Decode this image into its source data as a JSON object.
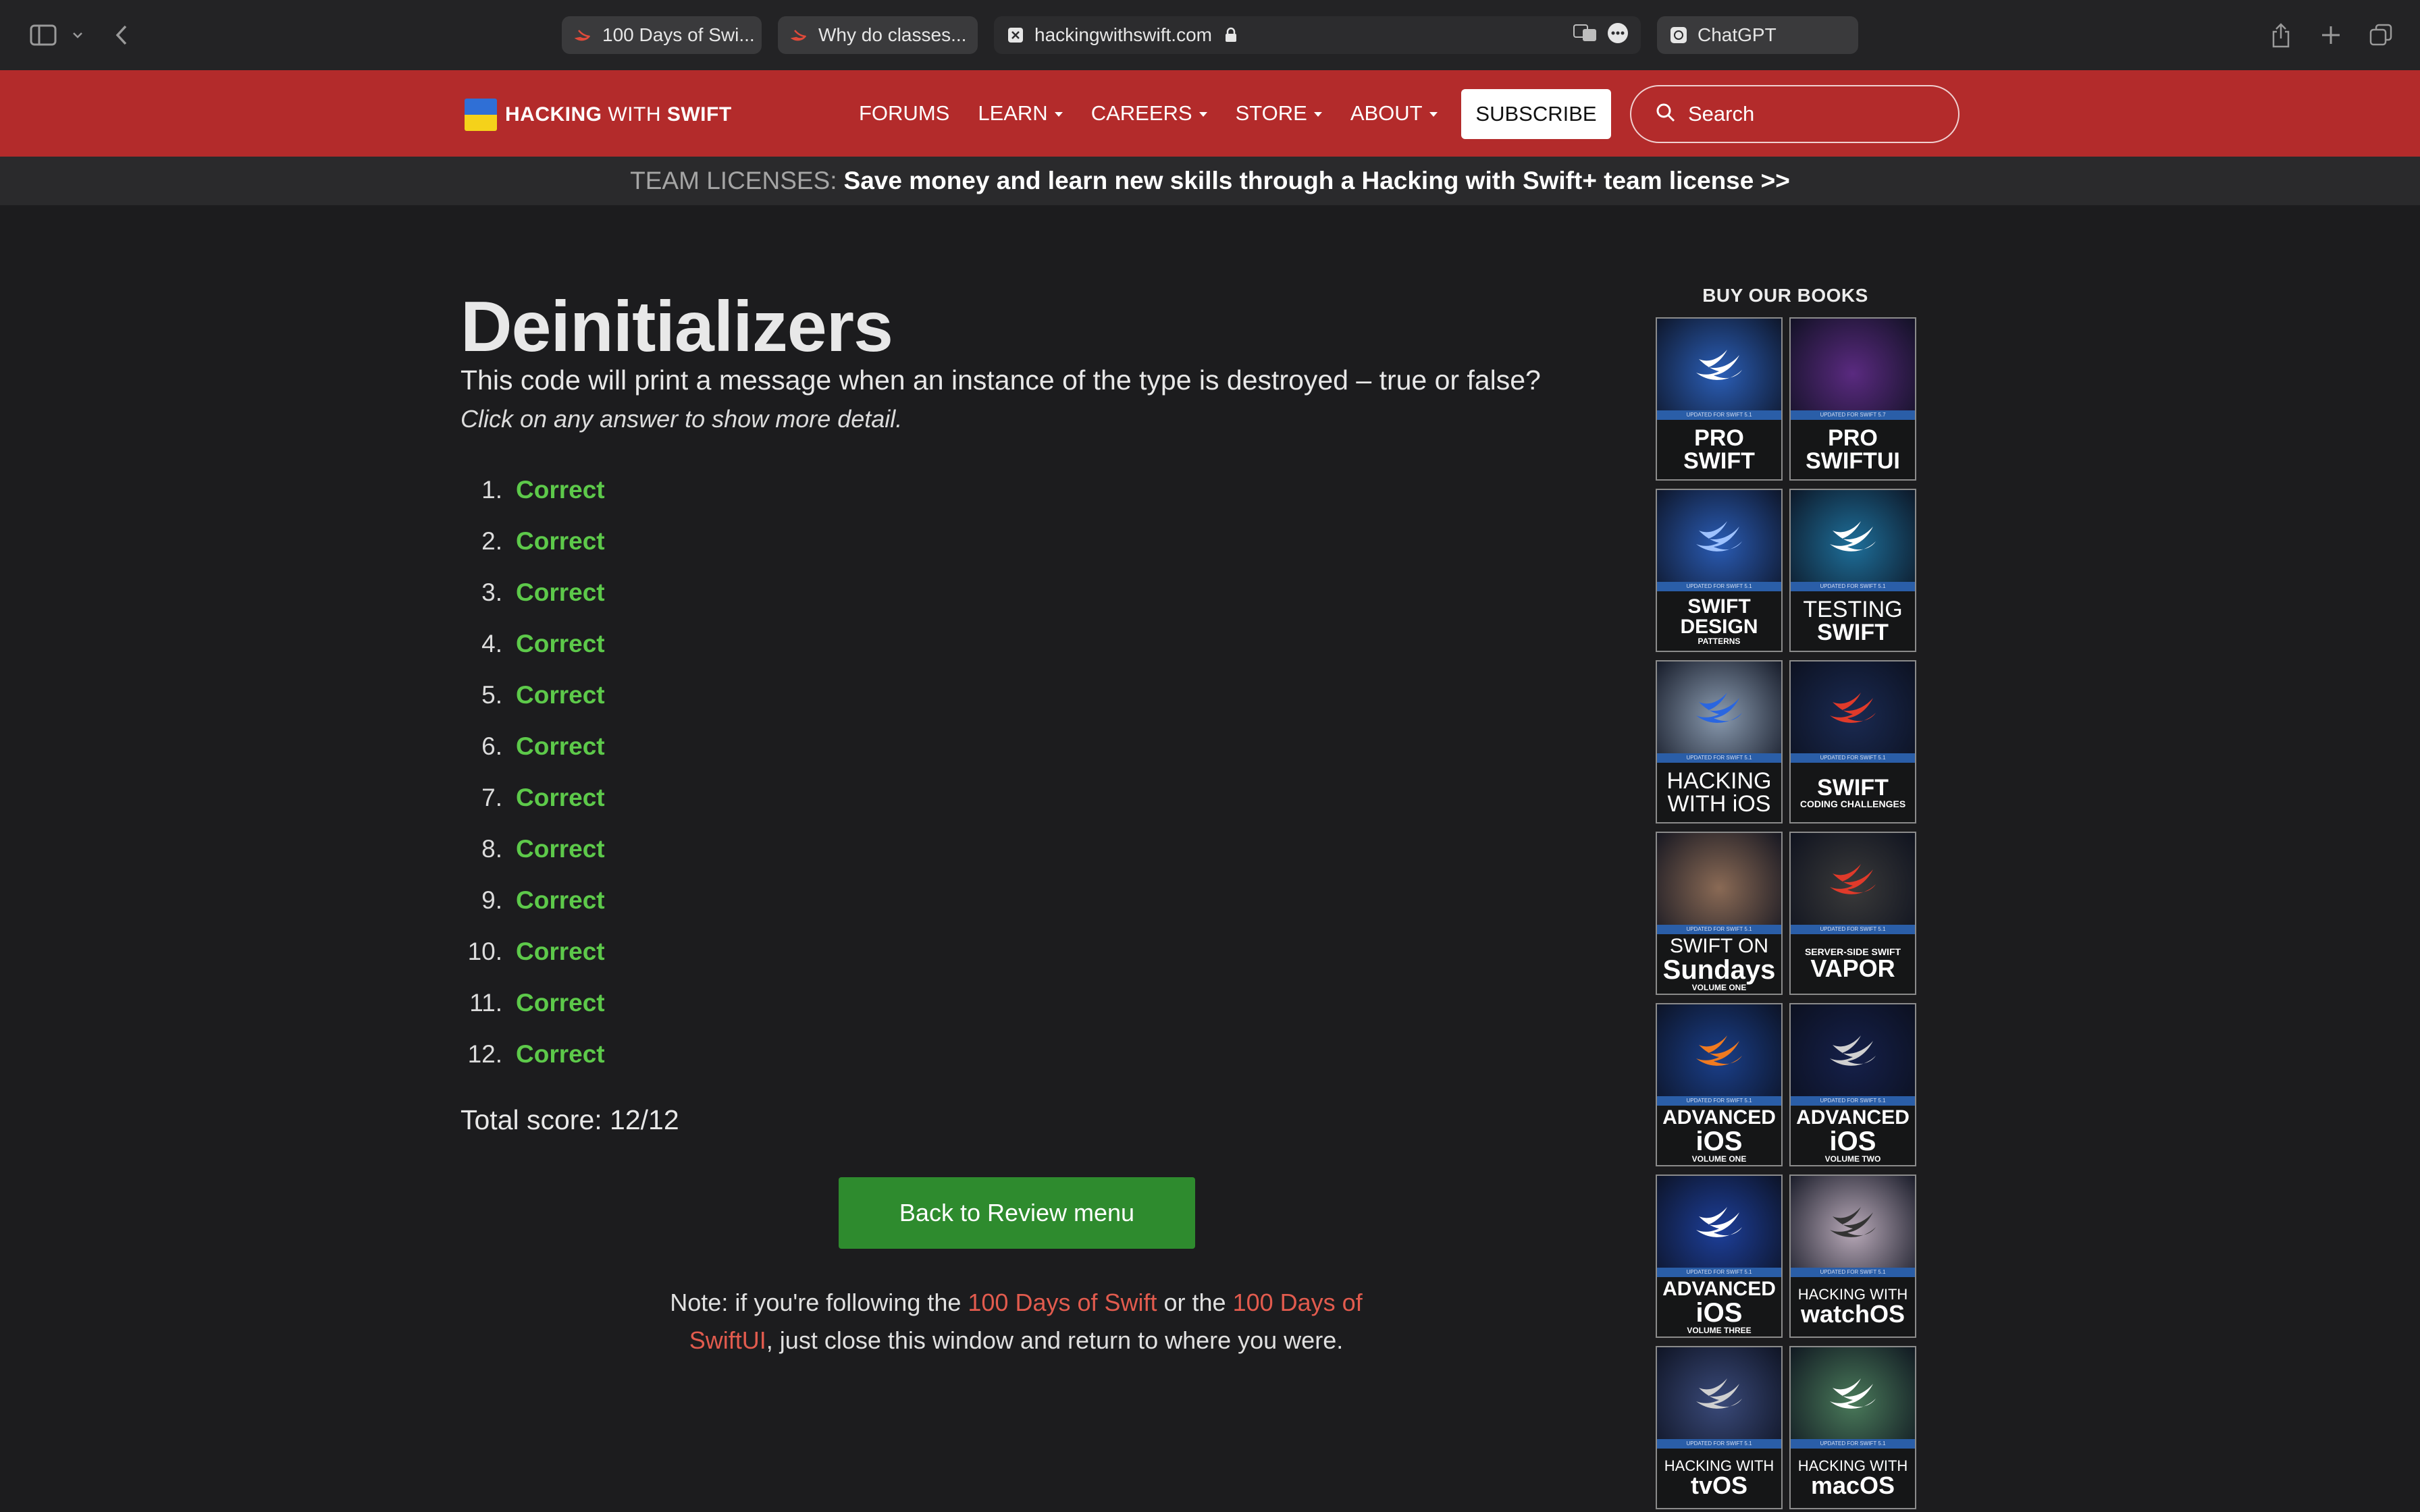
{
  "browser": {
    "tabs": [
      {
        "title": "100 Days of Swi..."
      },
      {
        "title": "Why do classes..."
      },
      {
        "title": "hackingwithswift.com"
      },
      {
        "title": "ChatGPT"
      }
    ]
  },
  "header": {
    "logo_bold": "HACKING",
    "logo_thin": "WITH",
    "logo_end": "SWIFT",
    "nav": [
      "FORUMS",
      "LEARN",
      "CAREERS",
      "STORE",
      "ABOUT"
    ],
    "subscribe": "SUBSCRIBE",
    "search_placeholder": "Search"
  },
  "banner": {
    "label": "TEAM LICENSES:",
    "message": "Save money and learn new skills through a Hacking with Swift+ team license >>"
  },
  "main": {
    "title": "Deinitializers",
    "question": "This code will print a message when an instance of the type is destroyed – true or false?",
    "hint": "Click on any answer to show more detail.",
    "answers": [
      {
        "num": "1.",
        "result": "Correct"
      },
      {
        "num": "2.",
        "result": "Correct"
      },
      {
        "num": "3.",
        "result": "Correct"
      },
      {
        "num": "4.",
        "result": "Correct"
      },
      {
        "num": "5.",
        "result": "Correct"
      },
      {
        "num": "6.",
        "result": "Correct"
      },
      {
        "num": "7.",
        "result": "Correct"
      },
      {
        "num": "8.",
        "result": "Correct"
      },
      {
        "num": "9.",
        "result": "Correct"
      },
      {
        "num": "10.",
        "result": "Correct"
      },
      {
        "num": "11.",
        "result": "Correct"
      },
      {
        "num": "12.",
        "result": "Correct"
      }
    ],
    "score": "Total score: 12/12",
    "back_button": "Back to Review menu",
    "note": {
      "prefix": "Note: if you're following the ",
      "link1": "100 Days of Swift",
      "middle": " or the ",
      "link2": "100 Days of SwiftUI",
      "suffix": ", just close this window and return to where you were."
    }
  },
  "sidebar": {
    "heading": "BUY OUR BOOKS",
    "books": [
      {
        "strip": "UPDATED FOR SWIFT 5.1",
        "lines": [
          "PRO",
          "SWIFT"
        ],
        "bg": "#2b5fb8",
        "mark": "#ffffff"
      },
      {
        "strip": "UPDATED FOR SWIFT 5.7",
        "lines": [
          "PRO",
          "SWIFTUI"
        ],
        "bg": "#5a2a80",
        "mark": ""
      },
      {
        "strip": "UPDATED FOR SWIFT 5.1",
        "lines": [
          "SWIFT",
          "DESIGN",
          "PATTERNS"
        ],
        "bg": "#2a5cb5",
        "mark": "#9ec2ff"
      },
      {
        "strip": "UPDATED FOR SWIFT 5.1",
        "lines": [
          "TESTING",
          "SWIFT"
        ],
        "bg": "#1e6f9a",
        "mark": "#ffffff"
      },
      {
        "strip": "UPDATED FOR SWIFT 5.1",
        "lines": [
          "HACKING",
          "WITH iOS"
        ],
        "bg": "#8a9bb0",
        "mark": "#2a66e0"
      },
      {
        "strip": "UPDATED FOR SWIFT 5.1",
        "lines": [
          "SWIFT",
          "CODING CHALLENGES"
        ],
        "bg": "#1a2a52",
        "mark": "#e03a2a"
      },
      {
        "strip": "UPDATED FOR SWIFT 5.1",
        "lines": [
          "SWIFT ON",
          "Sundays",
          "VOLUME ONE"
        ],
        "bg": "#8a6a55",
        "mark": ""
      },
      {
        "strip": "UPDATED FOR SWIFT 5.1",
        "lines": [
          "SERVER-SIDE SWIFT",
          "VAPOR"
        ],
        "bg": "#3a3a3a",
        "mark": "#e03a2a"
      },
      {
        "strip": "UPDATED FOR SWIFT 5.1",
        "lines": [
          "ADVANCED",
          "iOS",
          "VOLUME ONE"
        ],
        "bg": "#1a3f8a",
        "mark": "#f07a20"
      },
      {
        "strip": "UPDATED FOR SWIFT 5.1",
        "lines": [
          "ADVANCED",
          "iOS",
          "VOLUME TWO"
        ],
        "bg": "#15204a",
        "mark": "#d0d0d0"
      },
      {
        "strip": "UPDATED FOR SWIFT 5.1",
        "lines": [
          "ADVANCED",
          "iOS",
          "VOLUME THREE"
        ],
        "bg": "#1d3f9a",
        "mark": "#ffffff"
      },
      {
        "strip": "UPDATED FOR SWIFT 5.1",
        "lines": [
          "HACKING WITH",
          "watchOS"
        ],
        "bg": "#b8a9b8",
        "mark": "#333333"
      },
      {
        "strip": "UPDATED FOR SWIFT 5.1",
        "lines": [
          "HACKING WITH",
          "tvOS"
        ],
        "bg": "#3a4a7a",
        "mark": "#d0d0d0"
      },
      {
        "strip": "UPDATED FOR SWIFT 5.1",
        "lines": [
          "HACKING WITH",
          "macOS"
        ],
        "bg": "#4a7a5a",
        "mark": "#ffffff"
      }
    ]
  }
}
